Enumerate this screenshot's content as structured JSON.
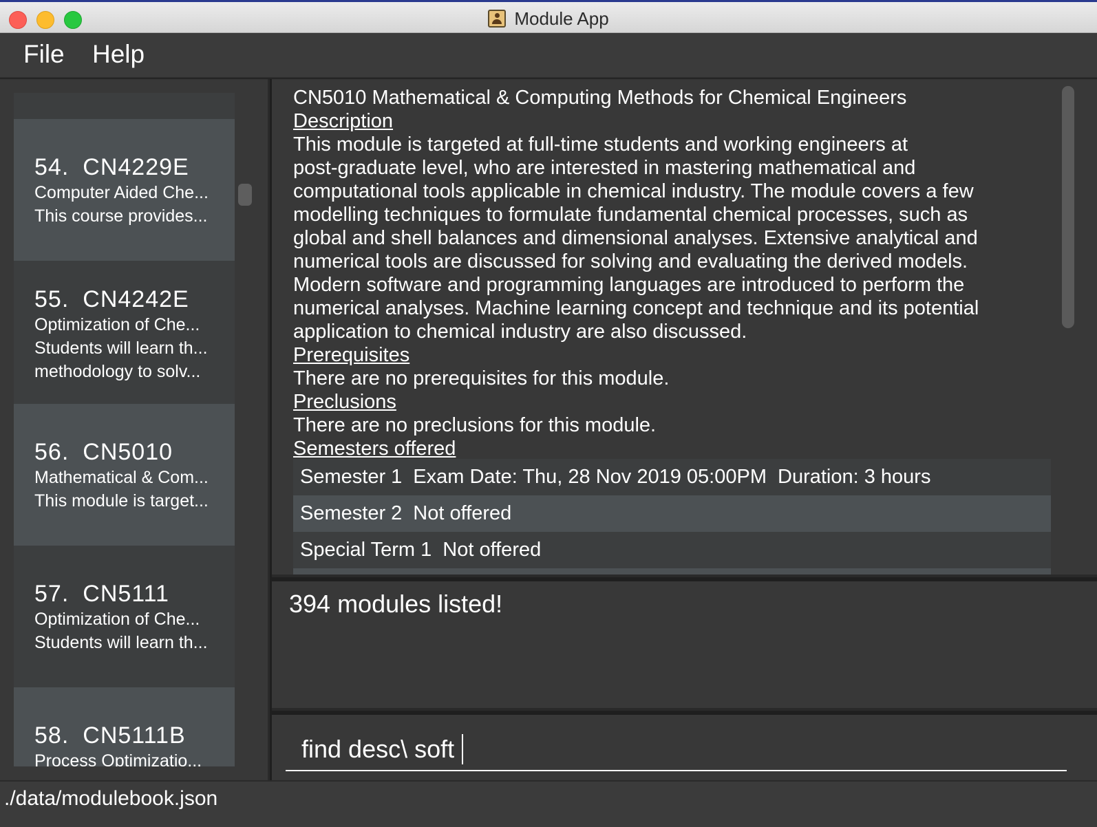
{
  "window": {
    "title": "Module App"
  },
  "menu": {
    "file_label": "File",
    "help_label": "Help"
  },
  "module_list": {
    "items": [
      {
        "index": "54.",
        "code": "CN4229E",
        "lines": [
          "Computer Aided Che...",
          "This course provides..."
        ]
      },
      {
        "index": "55.",
        "code": "CN4242E",
        "lines": [
          "Optimization of Che...",
          "Students will learn th...",
          "methodology to solv..."
        ]
      },
      {
        "index": "56.",
        "code": "CN5010",
        "lines": [
          "Mathematical & Com...",
          "This module is target..."
        ]
      },
      {
        "index": "57.",
        "code": "CN5111",
        "lines": [
          "Optimization of Che...",
          "Students will learn th..."
        ]
      },
      {
        "index": "58.",
        "code": "CN5111B",
        "lines": [
          "Process Optimizatio..."
        ]
      }
    ]
  },
  "detail": {
    "title": "CN5010 Mathematical & Computing Methods for Chemical Engineers",
    "description_heading": "Description",
    "description_lines": [
      "This module is targeted at full-time students and working engineers at",
      "post-graduate level, who are interested in mastering mathematical and",
      "computational tools applicable in chemical industry. The module covers a few",
      "modelling techniques to formulate fundamental chemical processes, such as",
      "global and shell balances and dimensional analyses. Extensive analytical and",
      "numerical tools are discussed for solving and evaluating the derived models.",
      "Modern software and programming languages are introduced to perform the",
      "numerical analyses. Machine learning concept and technique and its potential",
      "application to chemical industry are also discussed."
    ],
    "prerequisites_heading": "Prerequisites",
    "prerequisites_text": "There are no prerequisites for this module.",
    "preclusions_heading": "Preclusions",
    "preclusions_text": "There are no preclusions for this module.",
    "semesters_heading": "Semesters offered",
    "semesters": [
      {
        "name": "Semester 1",
        "exam": "Exam Date: Thu, 28 Nov 2019 05:00PM",
        "duration": "Duration: 3 hours"
      },
      {
        "name": "Semester 2",
        "exam": "Not offered",
        "duration": ""
      },
      {
        "name": "Special Term 1",
        "exam": "Not offered",
        "duration": ""
      }
    ]
  },
  "result": {
    "message": "394 modules listed!"
  },
  "command": {
    "value": "find desc\\ soft"
  },
  "status": {
    "file_path": "./data/modulebook.json"
  },
  "colors": {
    "background": "#383838",
    "card_light": "#4c5154",
    "card_dark": "#3c3e3f",
    "text": "#ffffff"
  }
}
